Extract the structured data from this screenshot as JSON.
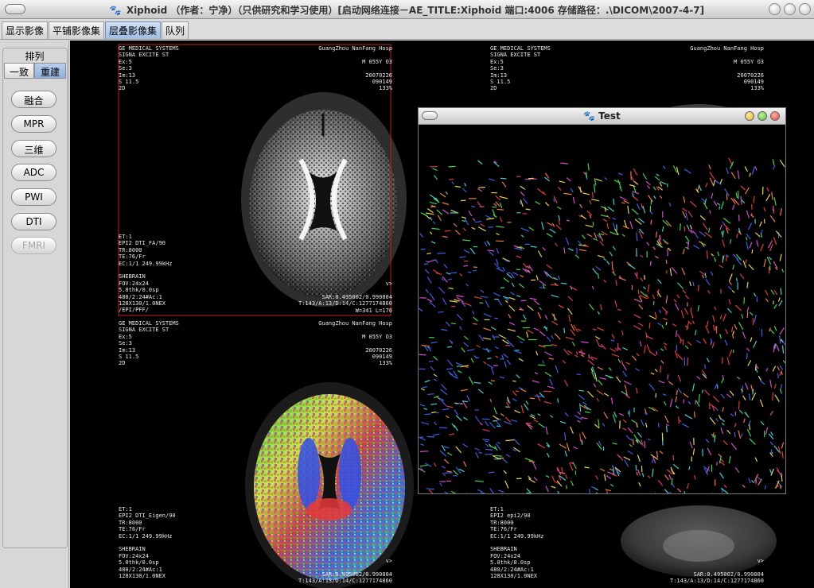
{
  "window": {
    "title": "Xiphoid （作者：宁净）（只供研究和学习使用）[启动网络连接－AE_TITLE:Xiphoid 端口:4006 存储路径：.\\DICOM\\2007-4-7]",
    "icon": "paw-icon"
  },
  "tabs": [
    "显示影像",
    "平铺影像集",
    "层叠影像集",
    "队列"
  ],
  "active_tab": "层叠影像集",
  "left_panel": {
    "group_title": "排列",
    "segments": [
      "一致",
      "重建"
    ],
    "active_segment": "重建",
    "buttons": [
      "融合",
      "MPR",
      "三维",
      "ADC",
      "PWI",
      "DTI",
      "FMRI"
    ],
    "disabled_button": "FMRI"
  },
  "viewports": {
    "top_left": {
      "tl": "GE MEDICAL SYSTEMS\nSIGNA EXCITE ST\nEx:5\nSe:3\nIm:13\nS 11.5\n2D",
      "tr": "GuangZhou NanFang Hosp\n\nM 055Y O3\n\n20070226\n090149\n133%",
      "bl": "ET:1\nEPI2 DTI_FA/90\nTR:8000\nTE:76/Fr\nEC:1/1 249.99kHz\n\nSHEBRAIN\nFOV:24x24\n5.0thk/0.0sp\n480/2:24#Ac:1\n128X130/1.0NEX\n/EPI/PFF/",
      "br": "v>\n\nSAR:0.495002/0.990004\nT:143/A:13/D:14/C:1277174860\nW=341 L=170"
    },
    "top_right": {
      "tl": "GE MEDICAL SYSTEMS\nSIGNA EXCITE ST\nEx:5\nSe:3\nIm:13\nS 11.5\n2D",
      "tr": "GuangZhou NanFang Hosp\n\nM 055Y O3\n\n20070226\n090149\n133%"
    },
    "bottom_left": {
      "tl": "GE MEDICAL SYSTEMS\nSIGNA EXCITE ST\nEx:5\nSe:3\nIm:13\nS 11.5\n2D",
      "tr": "GuangZhou NanFang Hosp\n\nM 055Y O3\n\n20070226\n090149\n133%",
      "bl": "ET:1\nEPI2 DTI_Eigen/90\nTR:8000\nTE:76/Fr\nEC:1/1 249.99kHz\n\nSHEBRAIN\nFOV:24x24\n5.0thk/0.0sp\n480/2:24#Ac:1\n128X130/1.0NEX",
      "br": "v>\n\nSAR:0.495002/0.990004\nT:143/A:13/D:14/C:1277174860"
    },
    "bottom_right": {
      "bl": "ET:1\nEPI2 epi2/90\nTR:8000\nTE:76/Fr\nEC:1/1 249.99kHz\n\nSHEBRAIN\nFOV:24x24\n5.0thk/0.0sp\n480/2:24#Ac:1\n128X130/1.0NEX",
      "br": "v>\n\nSAR:0.495002/0.990004\nT:143/A:13/D:14/C:1277174860"
    }
  },
  "test_window": {
    "title": "Test",
    "icon": "paw-icon"
  },
  "colors": {
    "selection_border": "#c0201e",
    "tab_active": "#a9c4e8",
    "close_button": "#e0443a",
    "minimize_button": "#e3b52c",
    "zoom_button": "#5fbf3a"
  }
}
